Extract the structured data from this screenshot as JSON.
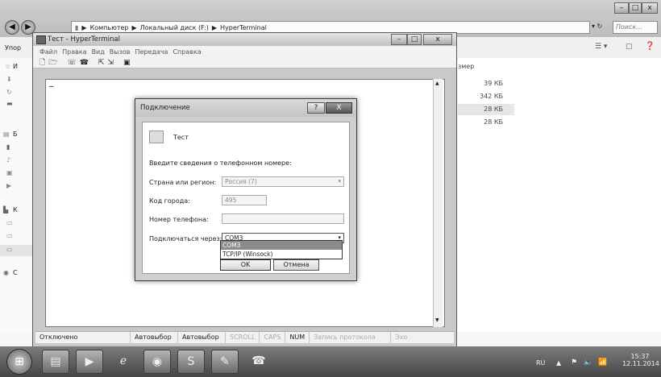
{
  "explorer": {
    "breadcrumb": [
      "Компьютер",
      "Локальный диск (F:)",
      "HyperTerminal"
    ],
    "search_placeholder": "Поиск...",
    "organize_label": "Упор",
    "size_header": "змер",
    "sizes": [
      "39 КБ",
      "342 КБ",
      "28 КБ",
      "28 КБ"
    ],
    "sidebar_letters": [
      "И",
      "Б",
      "К",
      "С"
    ]
  },
  "hyperterminal": {
    "title": "Тест - HyperTerminal",
    "menu": [
      "Файл",
      "Правка",
      "Вид",
      "Вызов",
      "Передача",
      "Справка"
    ],
    "cursor": "_",
    "status": {
      "connection": "Отключено",
      "autodetect1": "Автовыбор",
      "autodetect2": "Автовыбор",
      "scroll": "SCROLL",
      "caps": "CAPS",
      "num": "NUM",
      "capture": "Запись протокола",
      "echo": "Эхо"
    }
  },
  "dialog": {
    "title": "Подключение",
    "help_label": "?",
    "close_label": "X",
    "connection_name": "Тест",
    "instructions": "Введите сведения о телефонном номере:",
    "country_label": "Страна или регион:",
    "country_value": "Россия (7)",
    "area_label": "Код города:",
    "area_value": "495",
    "phone_label": "Номер телефона:",
    "phone_value": "",
    "connect_label": "Подключаться через:",
    "connect_value": "COM3",
    "connect_options": [
      "COM3",
      "TCP/IP (Winsock)"
    ],
    "ok_label": "OK",
    "cancel_label": "Отмена"
  },
  "taskbar": {
    "language": "RU",
    "time": "15:37",
    "date": "12.11.2014"
  }
}
